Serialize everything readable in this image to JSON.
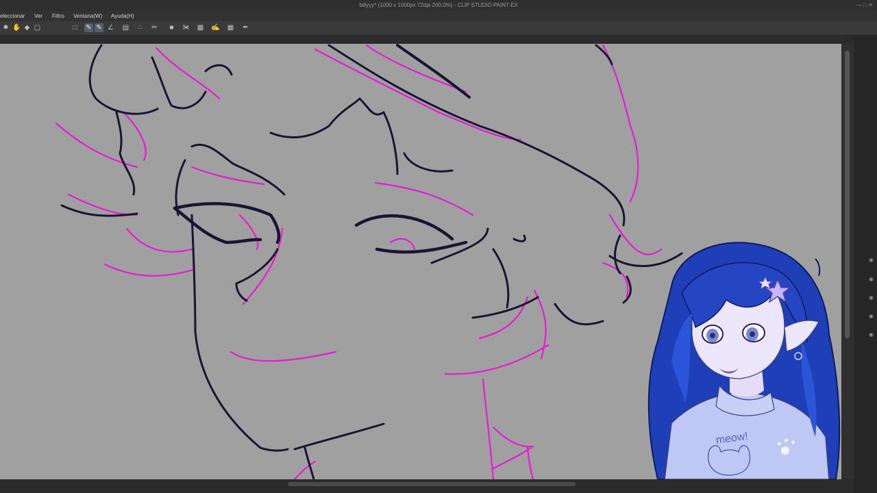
{
  "window": {
    "title": "billyyy* (1000 x 1000px 72dpi 200.0%) - CLIP STUDIO PAINT EX"
  },
  "menu": {
    "items": [
      "eleccionar",
      "Ver",
      "Filtro",
      "Ventana(W)",
      "Ayuda(H)"
    ]
  },
  "toolbar": {
    "icons": [
      "sparkle-icon",
      "hand-icon",
      "transform-icon",
      "crop-icon",
      "blank-icon",
      "brush-icon",
      "brush-alt-icon",
      "ruler-icon",
      "layer-icon",
      "lasso-icon",
      "pen-icon",
      "color-square-icon",
      "eraser-icon",
      "fill-icon",
      "pen-tool-icon",
      "select-icon",
      "pen-active-icon"
    ]
  },
  "canvas": {
    "background": "#a0a0a0",
    "lineart_color": "#1a1433",
    "sketch_color": "#e81ad7"
  },
  "colors": {
    "hair": "#1f3fb8",
    "sweater": "#bfc8f5"
  },
  "avatar": {
    "sweater_text": "meow!"
  }
}
